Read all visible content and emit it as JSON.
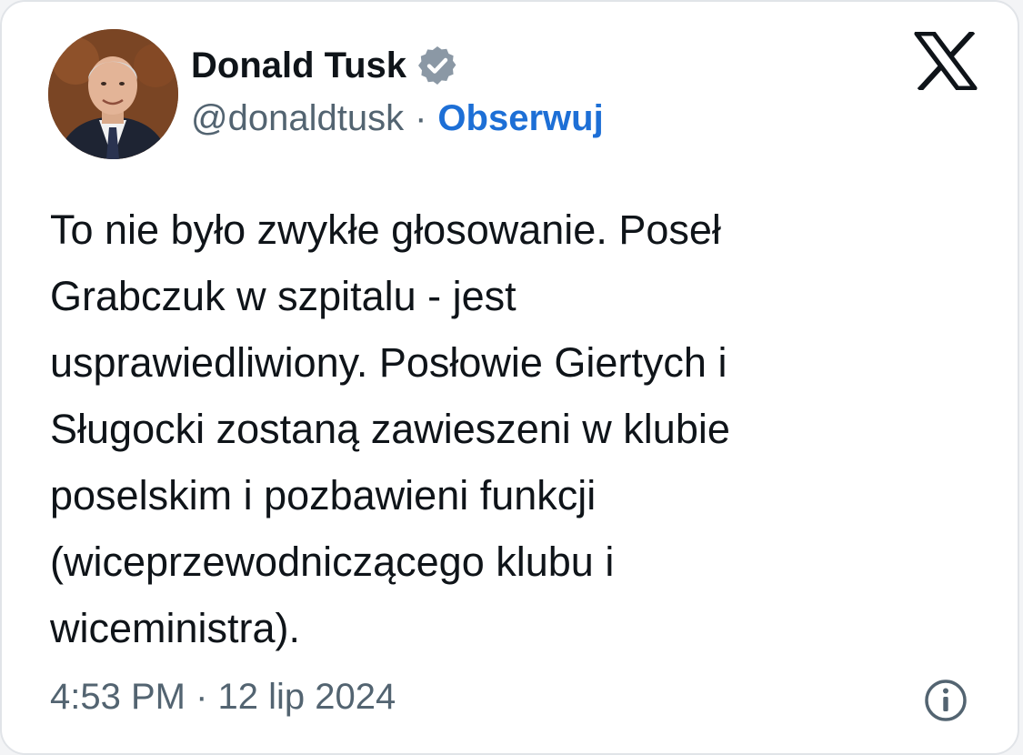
{
  "author": {
    "name": "Donald Tusk",
    "handle": "@donaldtusk",
    "separator": "·",
    "follow_label": "Obserwuj",
    "avatar_icon": "profile-photo",
    "verified_icon": "verified-badge-icon"
  },
  "platform": {
    "logo_icon": "x-logo-icon"
  },
  "tweet": {
    "text": "To nie było zwykłe głosowanie. Poseł\nGrabczuk w szpitalu - jest\nusprawiedliwiony. Posłowie Giertych i\nSługocki zostaną zawieszeni w klubie\nposelskim i pozbawieni funkcji\n(wiceprzewodniczącego klubu i\nwiceministra).",
    "timestamp": "4:53 PM · 12 lip 2024"
  },
  "footer": {
    "info_icon": "info-icon"
  },
  "colors": {
    "text": "#0f1419",
    "secondary": "#536471",
    "link": "#1d6fd6",
    "border": "#e1e4e8"
  }
}
